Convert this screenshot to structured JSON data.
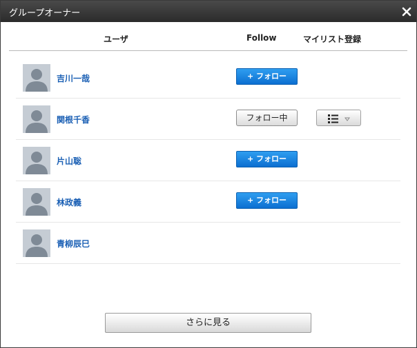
{
  "dialog": {
    "title": "グループオーナー",
    "close_icon": "close-icon"
  },
  "columns": {
    "user": "ユーザ",
    "follow": "Follow",
    "mylist": "マイリスト登録"
  },
  "users": [
    {
      "name": "吉川一哉",
      "follow_state": "not-following",
      "follow_label": "+ フォロー"
    },
    {
      "name": "関根千香",
      "follow_state": "following",
      "follow_label": "フォロー中",
      "mylist_icon": "list-icon"
    },
    {
      "name": "片山聡",
      "follow_state": "not-following",
      "follow_label": "+ フォロー"
    },
    {
      "name": "林政義",
      "follow_state": "not-following",
      "follow_label": "+ フォロー"
    },
    {
      "name": "青柳辰巳",
      "follow_state": "none"
    }
  ],
  "more_button": "さらに見る",
  "colors": {
    "titlebar": "#2b2b2b",
    "link": "#1a5fb4",
    "follow_button": "#0c6fd1"
  }
}
